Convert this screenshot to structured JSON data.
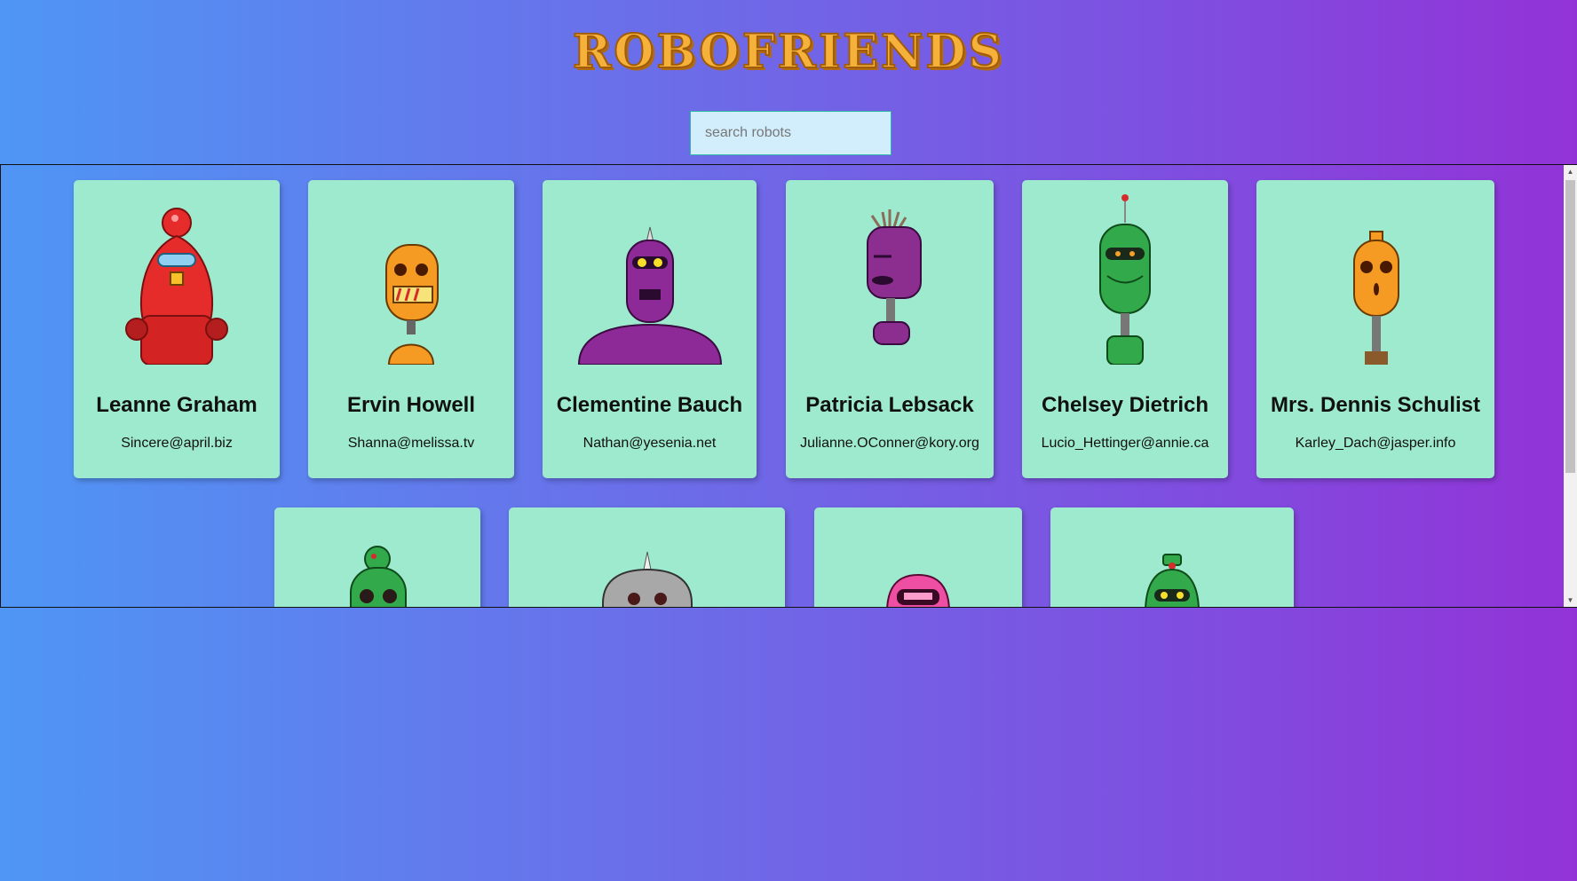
{
  "app": {
    "title": "ROBOFRIENDS"
  },
  "search": {
    "placeholder": "search robots",
    "value": ""
  },
  "robots": [
    {
      "name": "Leanne Graham",
      "email": "Sincere@april.biz",
      "color": "#e62b2b"
    },
    {
      "name": "Ervin Howell",
      "email": "Shanna@melissa.tv",
      "color": "#f59a22"
    },
    {
      "name": "Clementine Bauch",
      "email": "Nathan@yesenia.net",
      "color": "#8e2a97"
    },
    {
      "name": "Patricia Lebsack",
      "email": "Julianne.OConner@kory.org",
      "color": "#8b2e8f"
    },
    {
      "name": "Chelsey Dietrich",
      "email": "Lucio_Hettinger@annie.ca",
      "color": "#32a94a"
    },
    {
      "name": "Mrs. Dennis Schulist",
      "email": "Karley_Dach@jasper.info",
      "color": "#f59a22"
    },
    {
      "color": "#32a94a"
    },
    {
      "color": "#a8a8a8"
    },
    {
      "color": "#ee4fa3"
    },
    {
      "color": "#32a94a"
    }
  ],
  "colors": {
    "card_background": "#9eeacf",
    "title": "#f6b13a",
    "search_background": "#d2edfc"
  }
}
